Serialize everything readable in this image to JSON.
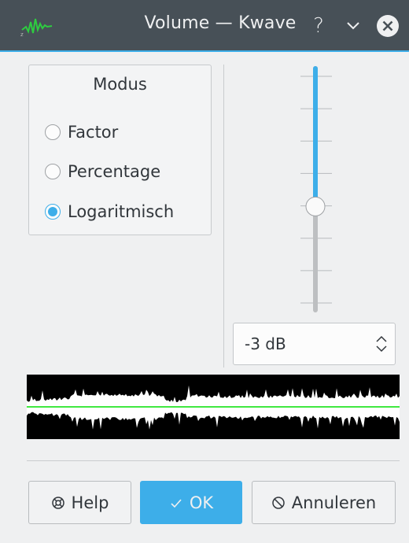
{
  "window": {
    "title": "Volume — Kwave",
    "help_glyph": "?",
    "icons": {
      "logo": "kwave-logo-icon",
      "minimize": "chevron-down-icon",
      "close": "close-circle-icon"
    }
  },
  "modus": {
    "title": "Modus",
    "options": [
      {
        "label": "Factor",
        "checked": false
      },
      {
        "label": "Percentage",
        "checked": false
      },
      {
        "label": "Logaritmisch",
        "checked": true
      }
    ]
  },
  "slider": {
    "position_fraction": 0.57,
    "tick_count": 8
  },
  "gain": {
    "value": "-3 dB"
  },
  "buttons": {
    "help": "Help",
    "ok": "OK",
    "cancel": "Annuleren"
  },
  "colors": {
    "accent": "#3daee9",
    "titlebar": "#475057",
    "waveform": "#ffffff",
    "waveform_background": "#000000",
    "center_line": "#00e000"
  }
}
